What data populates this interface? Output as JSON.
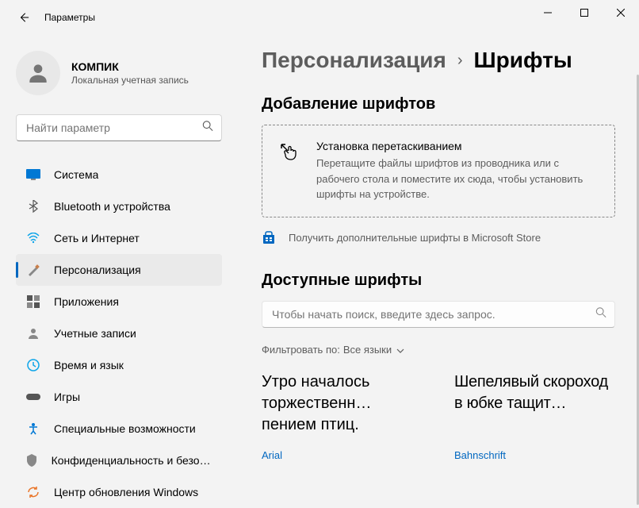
{
  "window": {
    "title": "Параметры"
  },
  "user": {
    "name": "КОМПИК",
    "sub": "Локальная учетная запись"
  },
  "search": {
    "placeholder": "Найти параметр"
  },
  "nav": {
    "items": [
      {
        "label": "Система"
      },
      {
        "label": "Bluetooth и устройства"
      },
      {
        "label": "Сеть и Интернет"
      },
      {
        "label": "Персонализация"
      },
      {
        "label": "Приложения"
      },
      {
        "label": "Учетные записи"
      },
      {
        "label": "Время и язык"
      },
      {
        "label": "Игры"
      },
      {
        "label": "Специальные возможности"
      },
      {
        "label": "Конфиденциальность и безопасность"
      },
      {
        "label": "Центр обновления Windows"
      }
    ]
  },
  "breadcrumb": {
    "parent": "Персонализация",
    "current": "Шрифты"
  },
  "add_section": {
    "heading": "Добавление шрифтов",
    "drop_title": "Установка перетаскиванием",
    "drop_desc": "Перетащите файлы шрифтов из проводника или с рабочего стола и поместите их сюда, чтобы установить шрифты на устройстве.",
    "store_link": "Получить дополнительные шрифты в Microsoft Store"
  },
  "avail_section": {
    "heading": "Доступные шрифты",
    "search_placeholder": "Чтобы начать поиск, введите здесь запрос.",
    "filter_label": "Фильтровать по:",
    "filter_value": "Все языки"
  },
  "fonts": [
    {
      "sample": "Утро началось торжественн… пением птиц.",
      "name": "Arial"
    },
    {
      "sample": "Шепелявый скороход в юбке тащит…",
      "name": "Bahnschrift"
    }
  ]
}
